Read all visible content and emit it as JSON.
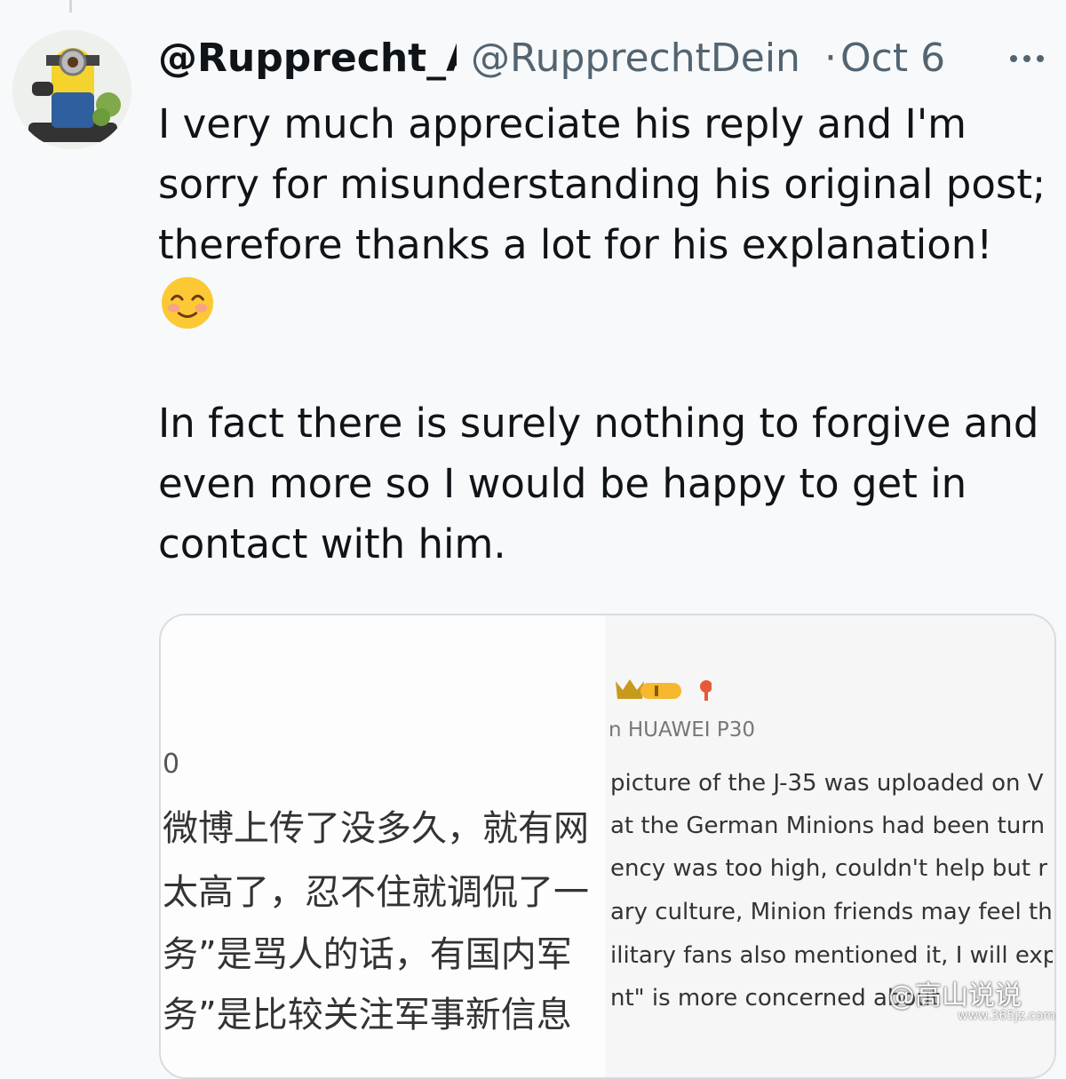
{
  "tweet": {
    "display_name": "@Rupprecht_A",
    "handle": "@RupprechtDein",
    "separator": "·",
    "date": "Oct 6",
    "lines": [
      "I very much appreciate his reply and I'm",
      "sorry for misunderstanding his original post;",
      "therefore thanks a lot for his explanation!"
    ],
    "emoji": "smiling-face-with-blush",
    "lines2": [
      "In fact there is surely nothing to forgive and",
      "even more so I would be happy to get in",
      "contact with him."
    ]
  },
  "embed": {
    "left_digit": "0",
    "chinese_lines": [
      "微博上传了没多久，就有网",
      "太高了，忍不住就调侃了一",
      "务”是骂人的话，有国内军",
      "务”是比较关注军事新信息"
    ],
    "device": "n HUAWEI P30",
    "english_lines": [
      "picture of the J-35 was uploaded on V",
      "at the German Minions had been turn",
      "ency was too high, couldn't help but r",
      "ary culture, Minion friends may feel th",
      "ilitary fans also mentioned it, I will exp",
      "nt\" is more concerned about"
    ]
  },
  "watermark": {
    "text": "@高山说说",
    "url": "www.365jz.com"
  },
  "colors": {
    "background": "#f7f9fa",
    "text_primary": "#0f1419",
    "text_secondary": "#536471",
    "border": "#d6dde2"
  }
}
